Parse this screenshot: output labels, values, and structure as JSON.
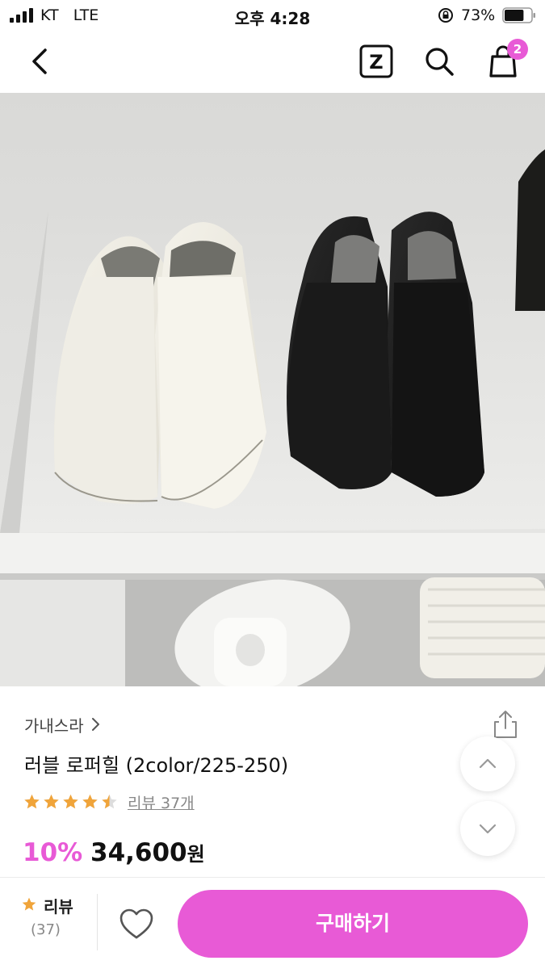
{
  "status_bar": {
    "carrier": "KT",
    "network": "LTE",
    "time": "오후 4:28",
    "battery_percent": "73%",
    "battery_level": 0.73
  },
  "nav": {
    "back_icon": "back-chevron-icon",
    "z_label": "Z",
    "search_icon": "search-icon",
    "cart_icon": "shopping-bag-icon",
    "cart_badge": "2"
  },
  "product": {
    "image": "product-photo",
    "brand": "가내스라",
    "title": "러블 로퍼힐 (2color/225-250)",
    "rating": 4.5,
    "review_link": "리뷰 37개",
    "discount": "10%",
    "price": "34,600",
    "currency": "원"
  },
  "colors": {
    "accent": "#e85ad6",
    "star": "#f0a43a"
  },
  "bottom_bar": {
    "review_label": "리뷰",
    "review_count": "(37)",
    "buy_label": "구매하기"
  }
}
